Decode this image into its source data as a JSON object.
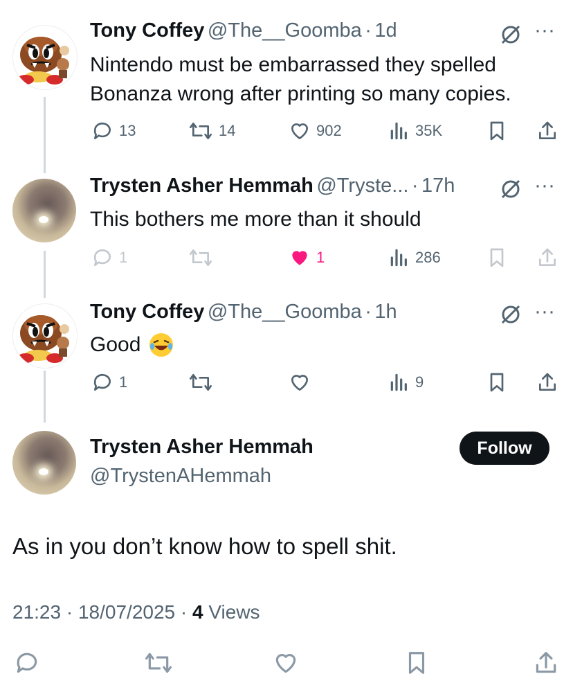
{
  "tweets": [
    {
      "name": "Tony Coffey",
      "handle": "@The__Goomba",
      "time": "1d",
      "text_line1": "Nintendo must be embarrassed they spelled",
      "text_line2": "Bonanza wrong after printing so many copies.",
      "replies": "13",
      "reposts": "14",
      "likes": "902",
      "views": "35K"
    },
    {
      "name": "Trysten Asher Hemmah",
      "handle": "@Tryste...",
      "time": "17h",
      "text_line1": "This bothers me more than it should",
      "replies": "1",
      "likes": "1",
      "views": "286"
    },
    {
      "name": "Tony Coffey",
      "handle": "@The__Goomba",
      "time": "1h",
      "text_line1": "Good",
      "replies": "1",
      "views": "9"
    }
  ],
  "sep": "·",
  "main": {
    "name": "Trysten Asher Hemmah",
    "handle": "@TrystenAHemmah",
    "follow_label": "Follow",
    "text": "As in you don’t know how to spell shit.",
    "time": "21:23",
    "date": "18/07/2025",
    "views_count": "4",
    "views_label": "Views"
  },
  "colors": {
    "like_active": "#f91880",
    "muted": "#536471",
    "thread_line": "#cfd9de"
  }
}
